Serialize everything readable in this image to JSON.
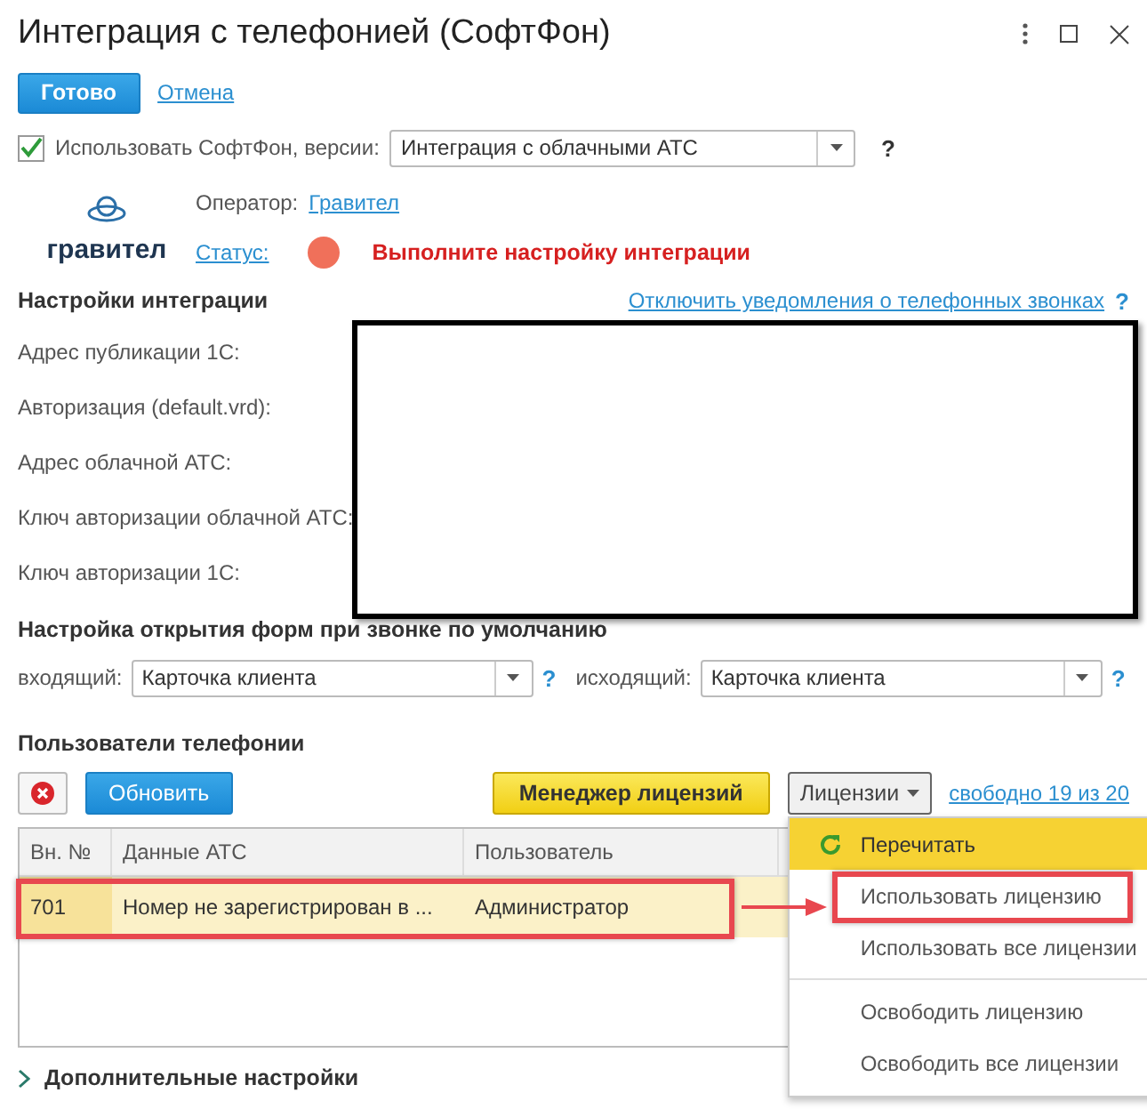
{
  "window": {
    "title": "Интеграция с телефонией (СофтФон)"
  },
  "actions": {
    "primary": "Готово",
    "cancel": "Отмена"
  },
  "use_softphone": {
    "label": "Использовать СофтФон, версии:",
    "checked": true,
    "version": "Интеграция с облачными АТС",
    "help": "?"
  },
  "operator": {
    "logo_text": "гравител",
    "label": "Оператор:",
    "link": "Гравител",
    "status_label": "Статус:",
    "status_text": "Выполните настройку интеграции"
  },
  "integration_settings": {
    "title": "Настройки интеграции",
    "link": "Отключить уведомления о телефонных звонках",
    "help": "?",
    "redacted": true,
    "fields": [
      {
        "label": "Адрес публикации 1С:"
      },
      {
        "label": "Авторизация (default.vrd):"
      },
      {
        "label": "Адрес облачной АТС:"
      },
      {
        "label": "Ключ авторизации облачной АТС:"
      },
      {
        "label": "Ключ авторизации 1С:"
      }
    ]
  },
  "form_defaults": {
    "title": "Настройка открытия форм при звонке по умолчанию",
    "incoming": {
      "label": "входящий:",
      "value": "Карточка клиента",
      "help": "?"
    },
    "outgoing": {
      "label": "исходящий:",
      "value": "Карточка клиента",
      "help": "?"
    }
  },
  "users": {
    "title": "Пользователи телефонии",
    "refresh": "Обновить",
    "license_manager": "Менеджер лицензий",
    "free": "свободно 19 из 20",
    "licenses_menu": {
      "label": "Лицензии",
      "expanded": true,
      "groups": [
        [
          {
            "label": "Перечитать",
            "kind": "refresh",
            "selected": true,
            "annotated": false
          },
          {
            "label": "Использовать лицензию",
            "kind": "plain",
            "selected": false,
            "annotated": true
          },
          {
            "label": "Использовать все лицензии",
            "kind": "plain",
            "selected": false,
            "annotated": false
          }
        ],
        [
          {
            "label": "Освободить лицензию",
            "kind": "plain",
            "selected": false,
            "annotated": false
          },
          {
            "label": "Освободить все лицензии",
            "kind": "plain",
            "selected": false,
            "annotated": false
          }
        ]
      ]
    },
    "table": {
      "columns": [
        "Вн. №",
        "Данные АТС",
        "Пользователь"
      ],
      "rows": [
        {
          "cells": [
            "701",
            "Номер не зарегистрирован в ...",
            "Администратор"
          ],
          "selected": true,
          "annotated": true
        }
      ]
    }
  },
  "more_settings": {
    "label": "Дополнительные настройки",
    "expanded": false
  }
}
